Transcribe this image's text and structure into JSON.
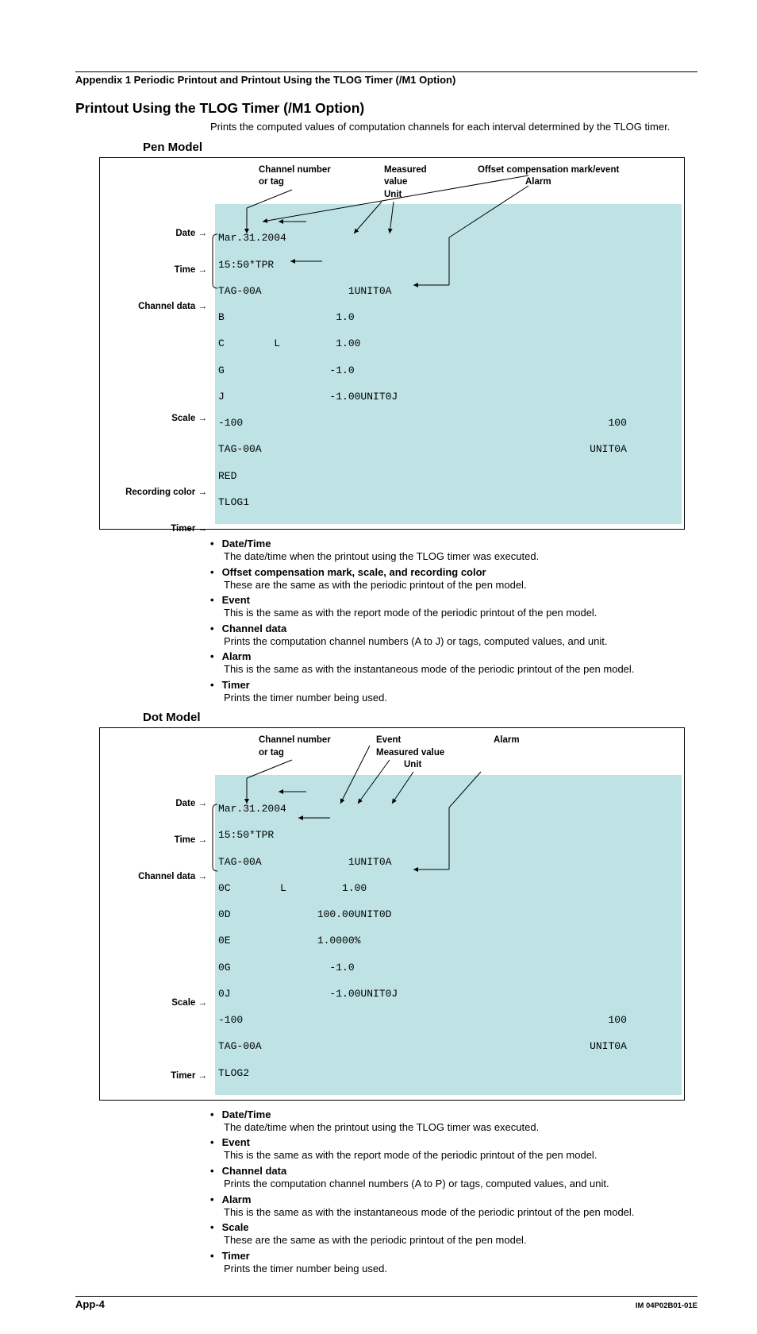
{
  "header": {
    "appendix_title": "Appendix 1  Periodic Printout and Printout Using the TLOG Timer (/M1 Option)"
  },
  "section": {
    "title": "Printout Using the TLOG Timer (/M1 Option)",
    "intro": "Prints the computed values of computation channels for each interval determined by the TLOG timer."
  },
  "pen": {
    "heading": "Pen Model",
    "top_labels": {
      "col1_l1": "Channel number",
      "col1_l2": "or tag",
      "col2_l1": "Measured",
      "col2_l2": "value",
      "col2_l3": "Unit",
      "col3_l1": "Offset compensation mark/event",
      "col3_l2": "Alarm"
    },
    "left": {
      "date": "Date",
      "time": "Time",
      "channel_data": "Channel data",
      "scale": "Scale",
      "recording_color": "Recording color",
      "timer": "Timer"
    },
    "mono": {
      "l1": "Mar.31.2004",
      "l2": "15:50*TPR",
      "l3": "TAG-00A              1UNIT0A",
      "l4": "B                  1.0",
      "l5": "C        L         1.00",
      "l6": "G                 -1.0",
      "l7": "J                 -1.00UNIT0J",
      "l8": "-100                                                           100",
      "l9": "TAG-00A                                                     UNIT0A",
      "l10": "RED",
      "l11": "TLOG1"
    },
    "notes": [
      {
        "term": "Date/Time",
        "def": "The date/time when the printout using the TLOG timer was executed."
      },
      {
        "term": "Offset compensation mark, scale, and recording color",
        "def": "These are the same as with the periodic printout of the pen model."
      },
      {
        "term": "Event",
        "def": "This is the same as with the report mode of the periodic printout of the pen model."
      },
      {
        "term": "Channel data",
        "def": "Prints the computation channel numbers (A to J) or tags, computed values, and unit."
      },
      {
        "term": "Alarm",
        "def": "This is the same as with the instantaneous mode of the periodic printout of the pen model."
      },
      {
        "term": "Timer",
        "def": "Prints the timer number being used."
      }
    ]
  },
  "dot": {
    "heading": "Dot Model",
    "top_labels": {
      "col1_l1": "Channel number",
      "col1_l2": "or tag",
      "col2_l1": "Event",
      "col2_l2": "Measured value",
      "col2_l3": "Unit",
      "col3_l1": "Alarm"
    },
    "left": {
      "date": "Date",
      "time": "Time",
      "channel_data": "Channel data",
      "scale": "Scale",
      "timer": "Timer"
    },
    "mono": {
      "l1": "Mar.31.2004",
      "l2": "15:50*TPR",
      "l3": "TAG-00A              1UNIT0A",
      "l4": "0C        L         1.00",
      "l5": "0D              100.00UNIT0D",
      "l6": "0E              1.0000%",
      "l7": "0G                -1.0",
      "l8": "0J                -1.00UNIT0J",
      "l9": "-100                                                           100",
      "l10": "TAG-00A                                                     UNIT0A",
      "l11": "TLOG2"
    },
    "notes": [
      {
        "term": "Date/Time",
        "def": "The date/time when the printout using the TLOG timer was executed."
      },
      {
        "term": "Event",
        "def": "This is the same as with the report mode of the periodic printout of the pen model."
      },
      {
        "term": "Channel data",
        "def": "Prints the computation channel numbers (A to P) or tags, computed values, and unit."
      },
      {
        "term": "Alarm",
        "def": "This is the same as with the instantaneous mode of the periodic printout of the pen model."
      },
      {
        "term": "Scale",
        "def": "These are the same as with the periodic printout of the pen model."
      },
      {
        "term": "Timer",
        "def": "Prints the timer number being used."
      }
    ]
  },
  "footer": {
    "page": "App-4",
    "doc": "IM 04P02B01-01E"
  }
}
